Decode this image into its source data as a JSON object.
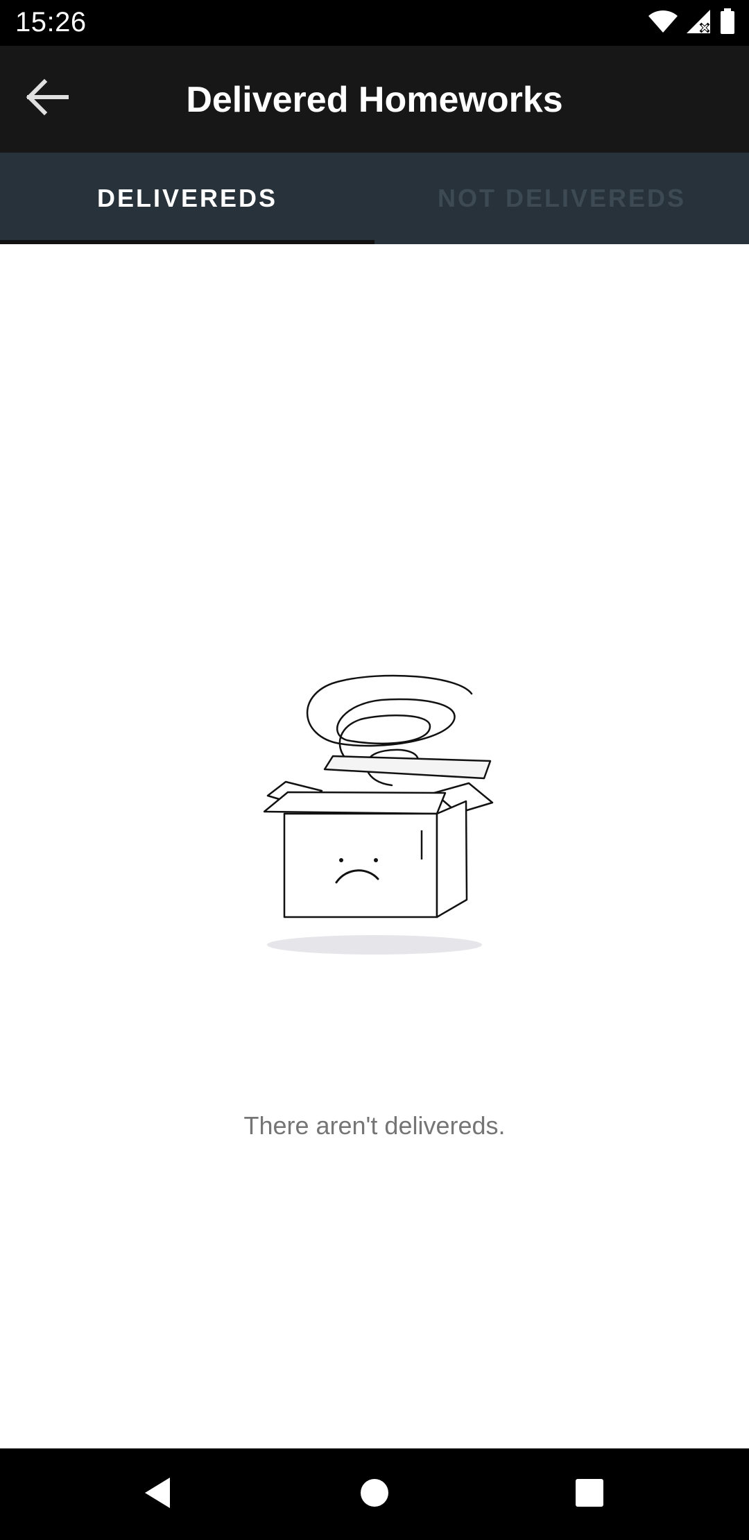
{
  "status_bar": {
    "time": "15:26",
    "icons": [
      "wifi-icon",
      "signal-icon",
      "battery-icon"
    ]
  },
  "toolbar": {
    "back_icon": "arrow-left-icon",
    "title": "Delivered Homeworks"
  },
  "tabs": [
    {
      "label": "DELIVEREDS",
      "selected": true
    },
    {
      "label": "NOT DELIVEREDS",
      "selected": false
    }
  ],
  "main": {
    "empty_message": "There aren't delivereds.",
    "illustration": "empty-box-icon"
  },
  "nav_bar": {
    "buttons": [
      "back-triangle-icon",
      "home-circle-icon",
      "recents-square-icon"
    ]
  },
  "colors": {
    "status_bar": "#000000",
    "toolbar": "#171717",
    "tab_bar": "#28323a",
    "tab_active_text": "#ffffff",
    "tab_inactive_text": "#3e4a53",
    "empty_text": "#757575"
  }
}
